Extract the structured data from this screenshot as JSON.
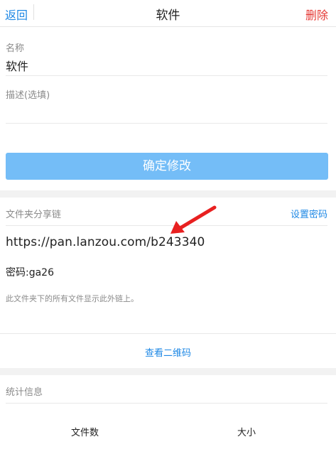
{
  "header": {
    "back_label": "返回",
    "title": "软件",
    "delete_label": "删除"
  },
  "form": {
    "name_label": "名称",
    "name_value": "软件",
    "desc_label": "描述(选填)",
    "desc_value": "",
    "confirm_label": "确定修改"
  },
  "share": {
    "section_title": "文件夹分享链",
    "set_password_label": "设置密码",
    "link": "https://pan.lanzou.com/b243340",
    "password_text": "密码:ga26",
    "hint": "此文件夹下的所有文件显示此外链上。",
    "qr_label": "查看二维码"
  },
  "stats": {
    "section_title": "统计信息",
    "columns": [
      "文件数",
      "大小"
    ]
  },
  "colors": {
    "accent": "#1e88e5",
    "danger": "#e53935",
    "button": "#74bdf7",
    "arrow": "#e82020"
  }
}
